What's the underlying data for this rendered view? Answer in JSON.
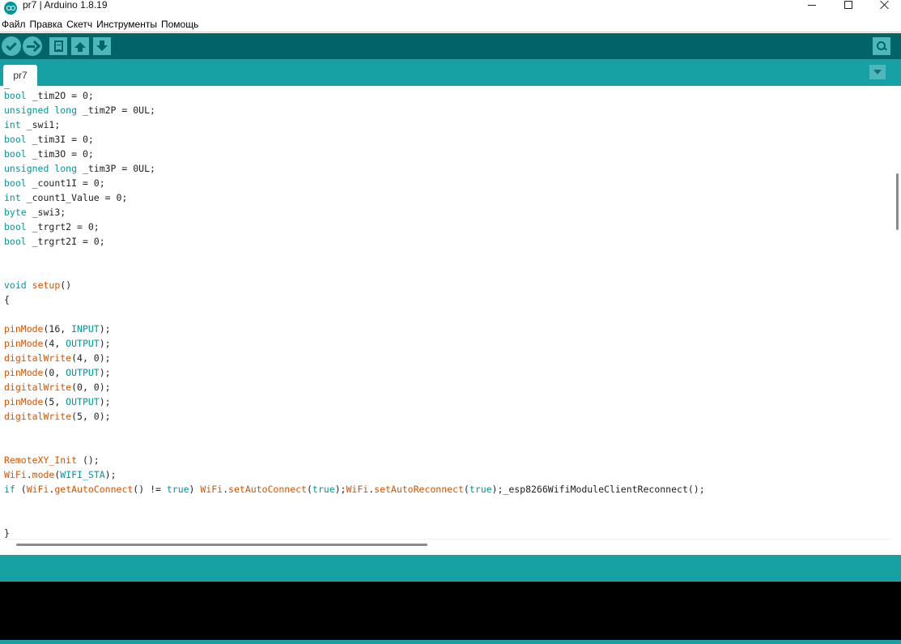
{
  "window": {
    "title": "pr7 | Arduino 1.8.19"
  },
  "menu": {
    "items": [
      "Файл",
      "Правка",
      "Скетч",
      "Инструменты",
      "Помощь"
    ]
  },
  "toolbar": {
    "icons": [
      "verify-icon",
      "upload-icon",
      "new-icon",
      "open-icon",
      "save-icon",
      "serial-monitor-icon"
    ]
  },
  "tabs": [
    {
      "label": "pr7"
    }
  ],
  "editor": {
    "lines": [
      [
        [
          "kw",
          "bool"
        ],
        [
          "txt",
          " _tim2O = 0;"
        ]
      ],
      [
        [
          "kw",
          "unsigned long"
        ],
        [
          "txt",
          " _tim2P = 0UL;"
        ]
      ],
      [
        [
          "kw",
          "int"
        ],
        [
          "txt",
          " _swi1;"
        ]
      ],
      [
        [
          "kw",
          "bool"
        ],
        [
          "txt",
          " _tim3I = 0;"
        ]
      ],
      [
        [
          "kw",
          "bool"
        ],
        [
          "txt",
          " _tim3O = 0;"
        ]
      ],
      [
        [
          "kw",
          "unsigned long"
        ],
        [
          "txt",
          " _tim3P = 0UL;"
        ]
      ],
      [
        [
          "kw",
          "bool"
        ],
        [
          "txt",
          " _count1I = 0;"
        ]
      ],
      [
        [
          "kw",
          "int"
        ],
        [
          "txt",
          " _count1_Value = 0;"
        ]
      ],
      [
        [
          "kw",
          "byte"
        ],
        [
          "txt",
          " _swi3;"
        ]
      ],
      [
        [
          "kw",
          "bool"
        ],
        [
          "txt",
          " _trgrt2 = 0;"
        ]
      ],
      [
        [
          "kw",
          "bool"
        ],
        [
          "txt",
          " _trgrt2I = 0;"
        ]
      ],
      [],
      [],
      [
        [
          "kw",
          "void"
        ],
        [
          "txt",
          " "
        ],
        [
          "fn",
          "setup"
        ],
        [
          "txt",
          "()"
        ]
      ],
      [
        [
          "txt",
          "{"
        ]
      ],
      [],
      [
        [
          "fn",
          "pinMode"
        ],
        [
          "txt",
          "(16, "
        ],
        [
          "lit",
          "INPUT"
        ],
        [
          "txt",
          ");"
        ]
      ],
      [
        [
          "fn",
          "pinMode"
        ],
        [
          "txt",
          "(4, "
        ],
        [
          "lit",
          "OUTPUT"
        ],
        [
          "txt",
          ");"
        ]
      ],
      [
        [
          "fn",
          "digitalWrite"
        ],
        [
          "txt",
          "(4, 0);"
        ]
      ],
      [
        [
          "fn",
          "pinMode"
        ],
        [
          "txt",
          "(0, "
        ],
        [
          "lit",
          "OUTPUT"
        ],
        [
          "txt",
          ");"
        ]
      ],
      [
        [
          "fn",
          "digitalWrite"
        ],
        [
          "txt",
          "(0, 0);"
        ]
      ],
      [
        [
          "fn",
          "pinMode"
        ],
        [
          "txt",
          "(5, "
        ],
        [
          "lit",
          "OUTPUT"
        ],
        [
          "txt",
          ");"
        ]
      ],
      [
        [
          "fn",
          "digitalWrite"
        ],
        [
          "txt",
          "(5, 0);"
        ]
      ],
      [],
      [],
      [
        [
          "fn",
          "RemoteXY_Init"
        ],
        [
          "txt",
          " ();"
        ]
      ],
      [
        [
          "fn",
          "WiFi"
        ],
        [
          "txt",
          "."
        ],
        [
          "fn",
          "mode"
        ],
        [
          "txt",
          "("
        ],
        [
          "lit",
          "WIFI_STA"
        ],
        [
          "txt",
          ");"
        ]
      ],
      [
        [
          "kw",
          "if"
        ],
        [
          "txt",
          " ("
        ],
        [
          "fn",
          "WiFi"
        ],
        [
          "txt",
          "."
        ],
        [
          "fn",
          "getAutoConnect"
        ],
        [
          "txt",
          "() != "
        ],
        [
          "kw",
          "true"
        ],
        [
          "txt",
          ") "
        ],
        [
          "fn",
          "WiFi"
        ],
        [
          "txt",
          "."
        ],
        [
          "fn",
          "setAutoConnect"
        ],
        [
          "txt",
          "("
        ],
        [
          "kw",
          "true"
        ],
        [
          "txt",
          ");"
        ],
        [
          "fn",
          "WiFi"
        ],
        [
          "txt",
          "."
        ],
        [
          "fn",
          "setAutoReconnect"
        ],
        [
          "txt",
          "("
        ],
        [
          "kw",
          "true"
        ],
        [
          "txt",
          ");_esp8266WifiModuleClientReconnect();"
        ]
      ],
      [],
      [],
      [
        [
          "txt",
          "}"
        ]
      ]
    ]
  },
  "colors": {
    "toolbar": "#006468",
    "tabbar": "#17a1a5",
    "button": "#4db7bb",
    "keyword": "#00979c",
    "function": "#d35400",
    "console": "#000000"
  }
}
